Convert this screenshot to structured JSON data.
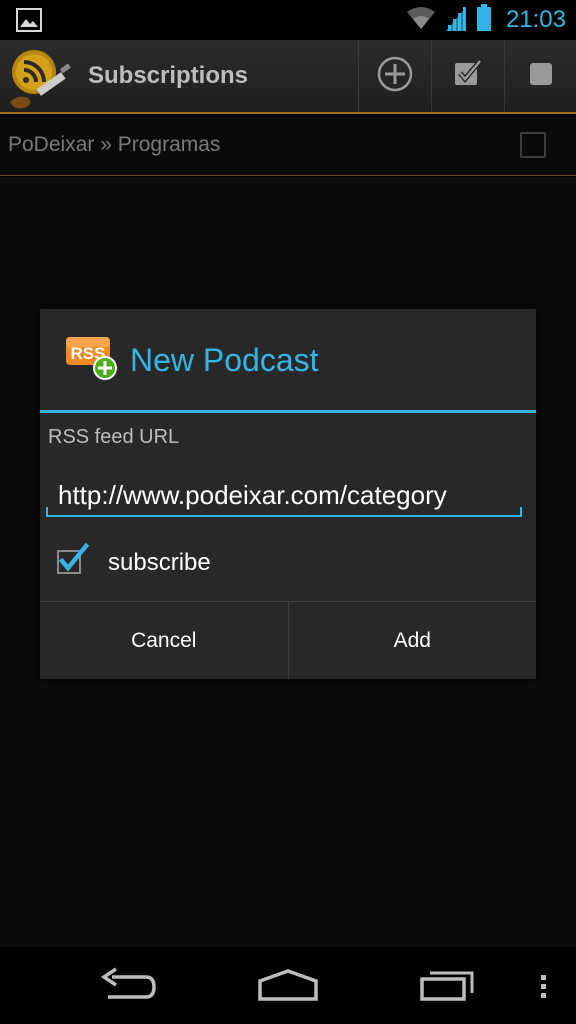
{
  "status_bar": {
    "time": "21:03",
    "icons": [
      "image-notification-icon",
      "wifi-icon",
      "signal-icon",
      "battery-icon"
    ]
  },
  "action_bar": {
    "title": "Subscriptions",
    "actions": [
      "add-circle-icon",
      "checked-box-icon",
      "square-icon"
    ]
  },
  "list": {
    "items": [
      {
        "label": "PoDeixar » Programas"
      }
    ]
  },
  "dialog": {
    "title": "New Podcast",
    "field_label": "RSS feed URL",
    "url_value": "http://www.podeixar.com/category",
    "subscribe_label": "subscribe",
    "subscribe_checked": true,
    "cancel_label": "Cancel",
    "add_label": "Add",
    "rss_icon_text": "RSS"
  },
  "colors": {
    "accent": "#33b5e5",
    "action_bar_divider": "#a96a1a",
    "dialog_bg": "#282828"
  },
  "nav_bar": {
    "buttons": [
      "back-icon",
      "home-icon",
      "recents-icon",
      "menu-icon"
    ]
  }
}
